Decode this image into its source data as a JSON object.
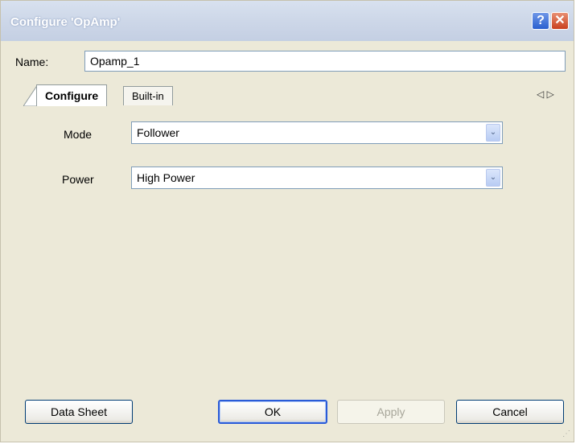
{
  "window": {
    "title": "Configure 'OpAmp'",
    "help": "?",
    "close": "✕"
  },
  "name_field": {
    "label": "Name:",
    "value": "Opamp_1"
  },
  "tabs": [
    {
      "label": "Configure",
      "active": true
    },
    {
      "label": "Built-in",
      "active": false
    }
  ],
  "tab_scroll": {
    "left": "◁",
    "right": "▷"
  },
  "settings": {
    "mode": {
      "label": "Mode",
      "value": "Follower"
    },
    "power": {
      "label": "Power",
      "value": "High Power"
    }
  },
  "dropdown_arrow": "⌄",
  "buttons": {
    "data_sheet": "Data Sheet",
    "ok": "OK",
    "apply": "Apply",
    "cancel": "Cancel"
  },
  "colors": {
    "titlebar": "#cdd7e8",
    "dialog_bg": "#ece9d8",
    "default_button_border": "#2a5bd7"
  }
}
